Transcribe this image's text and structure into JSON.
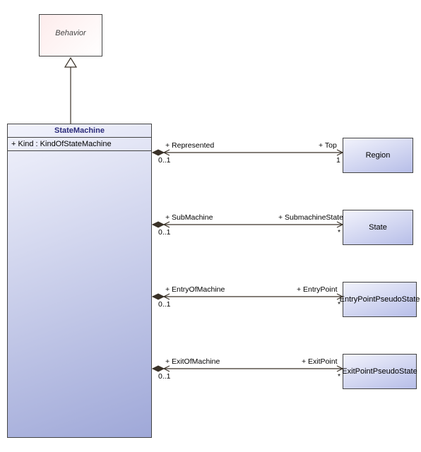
{
  "behavior": {
    "name": "Behavior"
  },
  "statemachine": {
    "name": "StateMachine",
    "attribute": "+ Kind : KindOfStateMachine"
  },
  "classes": {
    "region": "Region",
    "state": "State",
    "entry": "EntryPointPseudoState",
    "exit": "ExitPointPseudoState"
  },
  "assoc": {
    "region": {
      "leftRole": "+ Represented",
      "leftMult": "0..1",
      "rightRole": "+ Top",
      "rightMult": "1"
    },
    "state": {
      "leftRole": "+ SubMachine",
      "leftMult": "0..1",
      "rightRole": "+ SubmachineState",
      "rightMult": "*"
    },
    "entry": {
      "leftRole": "+ EntryOfMachine",
      "leftMult": "0..1",
      "rightRole": "+ EntryPoint",
      "rightMult": "*"
    },
    "exit": {
      "leftRole": "+ ExitOfMachine",
      "leftMult": "0..1",
      "rightRole": "+ ExitPoint",
      "rightMult": "*"
    }
  }
}
